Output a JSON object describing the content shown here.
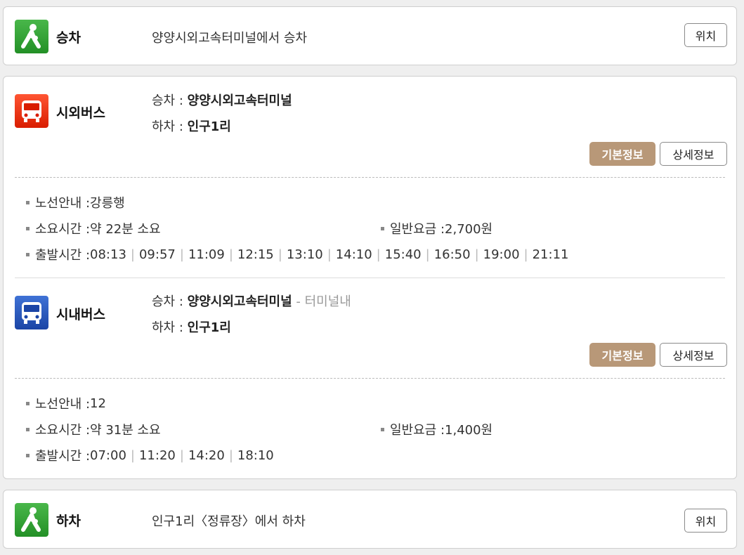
{
  "board": {
    "mode": "승차",
    "text": "양양시외고속터미널에서 승차",
    "button": "위치"
  },
  "intercity": {
    "mode": "시외버스",
    "board_label": "승차 : ",
    "board_stop": "양양시외고속터미널",
    "alight_label": "하차 : ",
    "alight_stop": "인구1리",
    "btn_basic": "기본정보",
    "btn_detail": "상세정보",
    "route_label": "노선안내 : ",
    "route": "강릉행",
    "duration_label": "소요시간 : ",
    "duration": "약 22분 소요",
    "fare_label": "일반요금 : ",
    "fare": "2,700원",
    "departure_label": "출발시간 : ",
    "departures": [
      "08:13",
      "09:57",
      "11:09",
      "12:15",
      "13:10",
      "14:10",
      "15:40",
      "16:50",
      "19:00",
      "21:11"
    ]
  },
  "city": {
    "mode": "시내버스",
    "board_label": "승차 : ",
    "board_stop": "양양시외고속터미널",
    "board_sub": " - 터미널내",
    "alight_label": "하차 : ",
    "alight_stop": "인구1리",
    "btn_basic": "기본정보",
    "btn_detail": "상세정보",
    "route_label": "노선안내 : ",
    "route": "12",
    "duration_label": "소요시간 : ",
    "duration": "약 31분 소요",
    "fare_label": "일반요금 : ",
    "fare": "1,400원",
    "departure_label": "출발시간 : ",
    "departures": [
      "07:00",
      "11:20",
      "14:20",
      "18:10"
    ]
  },
  "alight": {
    "mode": "하차",
    "text": "인구1리〈정류장〉에서 하차",
    "button": "위치"
  },
  "icons": {
    "walk": "walking-person-icon",
    "intercity": "intercity-bus-icon",
    "city": "city-bus-icon"
  },
  "colors": {
    "accent_button": "#b89878",
    "walk_green": "#2f9d32",
    "intercity_red": "#e8300f",
    "city_blue": "#264fb5"
  }
}
